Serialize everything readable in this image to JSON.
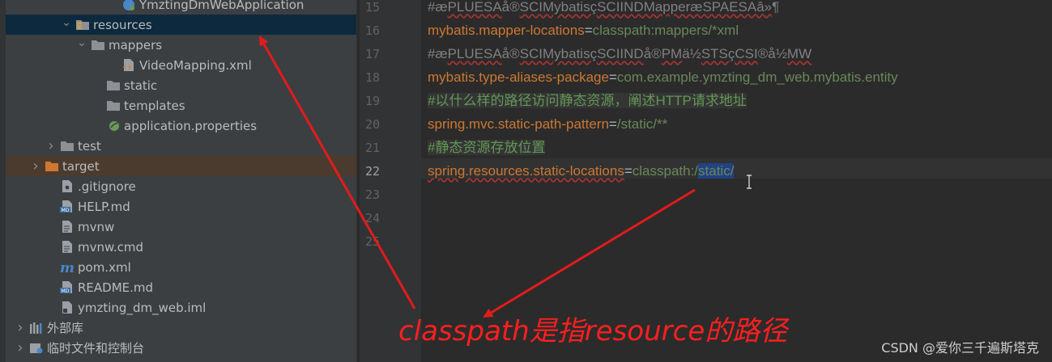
{
  "project_tree": {
    "items": [
      {
        "label": "YmztingDmWebApplication",
        "icon": "spring-class-icon",
        "chevron": "",
        "level": 7
      },
      {
        "label": "resources",
        "icon": "resources-folder-icon",
        "chevron": "down",
        "level": 4,
        "selected": true
      },
      {
        "label": "mappers",
        "icon": "folder-icon",
        "chevron": "down",
        "level": 5
      },
      {
        "label": "VideoMapping.xml",
        "icon": "xml-file-icon",
        "chevron": "",
        "level": 7
      },
      {
        "label": "static",
        "icon": "folder-icon",
        "chevron": "",
        "level": 6
      },
      {
        "label": "templates",
        "icon": "folder-icon",
        "chevron": "",
        "level": 6
      },
      {
        "label": "application.properties",
        "icon": "spring-properties-icon",
        "chevron": "",
        "level": 6
      },
      {
        "label": "test",
        "icon": "folder-icon",
        "chevron": "right",
        "level": 3
      },
      {
        "label": "target",
        "icon": "orange-folder-icon",
        "chevron": "right",
        "level": 2,
        "excluded": true
      },
      {
        "label": ".gitignore",
        "icon": "gitignore-file-icon",
        "chevron": "",
        "level": 3
      },
      {
        "label": "HELP.md",
        "icon": "md-file-icon",
        "chevron": "",
        "level": 3
      },
      {
        "label": "mvnw",
        "icon": "text-file-icon",
        "chevron": "",
        "level": 3
      },
      {
        "label": "mvnw.cmd",
        "icon": "text-file-icon",
        "chevron": "",
        "level": 3
      },
      {
        "label": "pom.xml",
        "icon": "maven-icon",
        "chevron": "",
        "level": 3
      },
      {
        "label": "README.md",
        "icon": "md-file-icon",
        "chevron": "",
        "level": 3
      },
      {
        "label": "ymzting_dm_web.iml",
        "icon": "iml-file-icon",
        "chevron": "",
        "level": 3
      },
      {
        "label": "外部库",
        "icon": "libraries-icon",
        "chevron": "right",
        "level": 1
      },
      {
        "label": "临时文件和控制台",
        "icon": "scratches-icon",
        "chevron": "right",
        "level": 1
      }
    ]
  },
  "editor": {
    "current_line": "22",
    "lines": [
      {
        "num": "15",
        "parts": [
          {
            "t": "#æ",
            "c": "c"
          },
          {
            "t": "PLUESA",
            "c": "cwavy"
          },
          {
            "t": "å®",
            "c": "c"
          },
          {
            "t": "SCIMybatisç",
            "c": "cwavy"
          },
          {
            "t": "SCIINDMapperæSPAESAâ»",
            "c": "cwavy"
          },
          {
            "t": "¶",
            "c": "c"
          }
        ]
      },
      {
        "num": "16",
        "parts": [
          {
            "t": "mybatis.mapper-locations",
            "c": "k"
          },
          {
            "t": "=",
            "c": "eq"
          },
          {
            "t": "classpath:mappers/*xml",
            "c": "v"
          }
        ]
      },
      {
        "num": "17",
        "parts": [
          {
            "t": "#æ",
            "c": "c"
          },
          {
            "t": "PLUESA",
            "c": "cwavy"
          },
          {
            "t": "å®",
            "c": "c"
          },
          {
            "t": "SCIMybatisç",
            "c": "cwavy"
          },
          {
            "t": "SCIIND",
            "c": "cwavy"
          },
          {
            "t": "å®",
            "c": "c"
          },
          {
            "t": "PM",
            "c": "cwavy"
          },
          {
            "t": "ä½",
            "c": "c"
          },
          {
            "t": "STSç",
            "c": "cwavy"
          },
          {
            "t": "CSI",
            "c": "cwavy"
          },
          {
            "t": "®å½",
            "c": "c"
          },
          {
            "t": "MW",
            "c": "cwavy"
          }
        ]
      },
      {
        "num": "18",
        "parts": [
          {
            "t": "mybatis.type-aliases-package",
            "c": "k"
          },
          {
            "t": "=",
            "c": "eq"
          },
          {
            "t": "com.example.ymzting_dm_web.mybatis.entity",
            "c": "v"
          }
        ]
      },
      {
        "num": "19",
        "parts": [
          {
            "t": "#以什么样的路径访问静态资源，阐述HTTP请求地址",
            "c": "cm"
          }
        ]
      },
      {
        "num": "20",
        "parts": [
          {
            "t": "spring.mvc.static-path-pattern",
            "c": "k"
          },
          {
            "t": "=",
            "c": "eq"
          },
          {
            "t": "/static/**",
            "c": "v"
          }
        ]
      },
      {
        "num": "21",
        "parts": [
          {
            "t": "#静态资源存放位置",
            "c": "cm"
          }
        ]
      },
      {
        "num": "22",
        "parts": [
          {
            "t": "spring.resources.static-locations",
            "c": "kwavy"
          },
          {
            "t": "=",
            "c": "eq"
          },
          {
            "t": "classpath:/",
            "c": "v"
          },
          {
            "t": "static/",
            "c": "sel"
          }
        ]
      },
      {
        "num": "23",
        "parts": []
      },
      {
        "num": "24",
        "parts": []
      },
      {
        "num": "25",
        "parts": []
      }
    ]
  },
  "annotation": {
    "text": "classpath是指resource的路径",
    "color": "#ff1f1f"
  },
  "watermark": "CSDN @爱你三千遍斯塔克",
  "colors": {
    "keyword": "#cc7832",
    "value": "#6a8759",
    "comment": "#808080",
    "selection": "#214283",
    "tree_selected": "#0d293e"
  }
}
